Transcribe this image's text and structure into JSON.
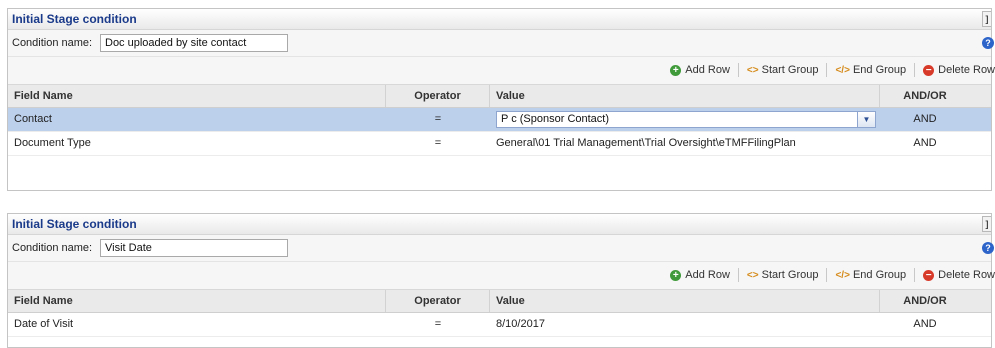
{
  "panels": [
    {
      "title": "Initial Stage condition",
      "condition_label": "Condition name:",
      "condition_value": "Doc uploaded by site contact",
      "toolbar": {
        "add_row": "Add Row",
        "start_group": "Start Group",
        "end_group": "End Group",
        "delete_row": "Delete Row"
      },
      "columns": [
        "Field Name",
        "Operator",
        "Value",
        "AND/OR"
      ],
      "rows": [
        {
          "field": "Contact",
          "operator": "=",
          "value": "P c (Sponsor Contact)",
          "andor": "AND"
        },
        {
          "field": "Document Type",
          "operator": "=",
          "value": "General\\01 Trial Management\\Trial Oversight\\eTMFFilingPlan",
          "andor": "AND"
        }
      ]
    },
    {
      "title": "Initial Stage condition",
      "condition_label": "Condition name:",
      "condition_value": "Visit Date",
      "toolbar": {
        "add_row": "Add Row",
        "start_group": "Start Group",
        "end_group": "End Group",
        "delete_row": "Delete Row"
      },
      "columns": [
        "Field Name",
        "Operator",
        "Value",
        "AND/OR"
      ],
      "rows": [
        {
          "field": "Date of Visit",
          "operator": "=",
          "value": "8/10/2017",
          "andor": "AND"
        }
      ]
    }
  ],
  "icons": {
    "help": "question-icon",
    "add": "plus-circle-icon",
    "start_group": "code-open-icon",
    "end_group": "code-close-icon",
    "delete": "minus-circle-icon",
    "dropdown": "chevron-down-icon"
  },
  "colors": {
    "title": "#1a3a8a",
    "selected_row": "#bcd0ec",
    "add": "#3f9a3a",
    "delete": "#d83a2a",
    "group": "#d58a18",
    "help": "#2c64c9"
  }
}
